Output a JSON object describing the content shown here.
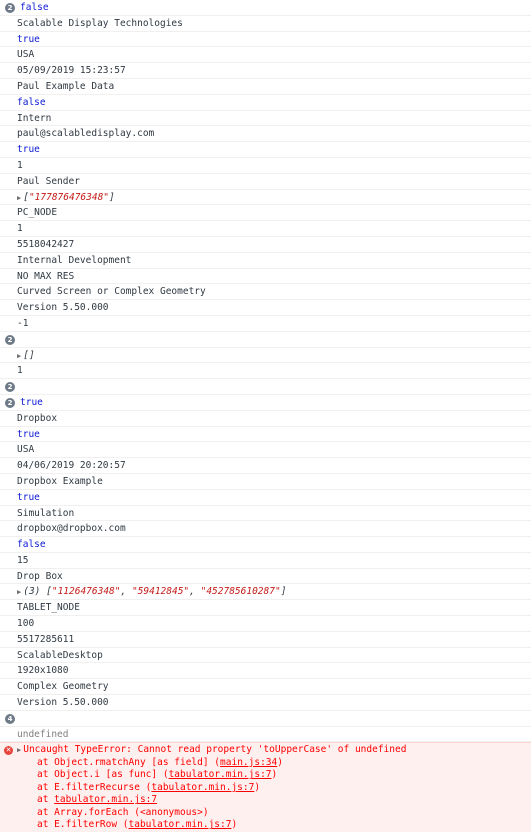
{
  "rows": [
    {
      "badge": "2",
      "text": "false",
      "kind": "kw"
    },
    {
      "text": "Scalable Display Technologies"
    },
    {
      "text": "true",
      "kind": "kw"
    },
    {
      "text": "USA"
    },
    {
      "text": "05/09/2019 15:23:57"
    },
    {
      "text": "Paul Example Data"
    },
    {
      "text": "false",
      "kind": "kw"
    },
    {
      "text": "Intern"
    },
    {
      "text": "paul@scalabledisplay.com"
    },
    {
      "text": "true",
      "kind": "kw"
    },
    {
      "text": "1"
    },
    {
      "text": "Paul Sender"
    },
    {
      "kind": "array",
      "items": [
        "\"177876476348\""
      ]
    },
    {
      "text": "PC_NODE"
    },
    {
      "text": "1"
    },
    {
      "text": "5518042427"
    },
    {
      "text": "Internal Development"
    },
    {
      "text": "NO MAX RES"
    },
    {
      "text": "Curved Screen or Complex Geometry"
    },
    {
      "text": "Version 5.50.000"
    },
    {
      "text": "-1"
    },
    {
      "badge": "2",
      "text": ""
    },
    {
      "kind": "array",
      "items": []
    },
    {
      "text": "1"
    },
    {
      "badge": "2",
      "text": ""
    },
    {
      "badge": "2",
      "text": "true",
      "kind": "kw"
    },
    {
      "text": "Dropbox"
    },
    {
      "text": "true",
      "kind": "kw"
    },
    {
      "text": "USA"
    },
    {
      "text": "04/06/2019 20:20:57"
    },
    {
      "text": "Dropbox Example"
    },
    {
      "text": "true",
      "kind": "kw"
    },
    {
      "text": "Simulation"
    },
    {
      "text": "dropbox@dropbox.com"
    },
    {
      "text": "false",
      "kind": "kw"
    },
    {
      "text": "15"
    },
    {
      "text": "Drop Box"
    },
    {
      "kind": "array",
      "count": "(3)",
      "items": [
        "\"1126476348\"",
        "\"59412845\"",
        "\"452785610287\""
      ]
    },
    {
      "text": "TABLET_NODE"
    },
    {
      "text": "100"
    },
    {
      "text": "5517285611"
    },
    {
      "text": "ScalableDesktop"
    },
    {
      "text": "1920x1080"
    },
    {
      "text": "Complex Geometry"
    },
    {
      "text": "Version 5.50.000"
    },
    {
      "badge": "4",
      "text": ""
    },
    {
      "text": "undefined",
      "kind": "muted"
    }
  ],
  "error": {
    "message": "Uncaught TypeError: Cannot read property 'toUpperCase' of undefined",
    "stack": [
      {
        "text": "at Object.rmatchAny [as field] (",
        "src": "main.js:34",
        "end": ")"
      },
      {
        "text": "at Object.i [as func] (",
        "src": "tabulator.min.js:7",
        "end": ")"
      },
      {
        "text": "at E.filterRecurse (",
        "src": "tabulator.min.js:7",
        "end": ")"
      },
      {
        "text": "at ",
        "src": "tabulator.min.js:7",
        "end": ""
      },
      {
        "text": "at Array.forEach (<anonymous>)",
        "src": "",
        "end": ""
      },
      {
        "text": "at E.filterRow (",
        "src": "tabulator.min.js:7",
        "end": ")"
      }
    ]
  }
}
